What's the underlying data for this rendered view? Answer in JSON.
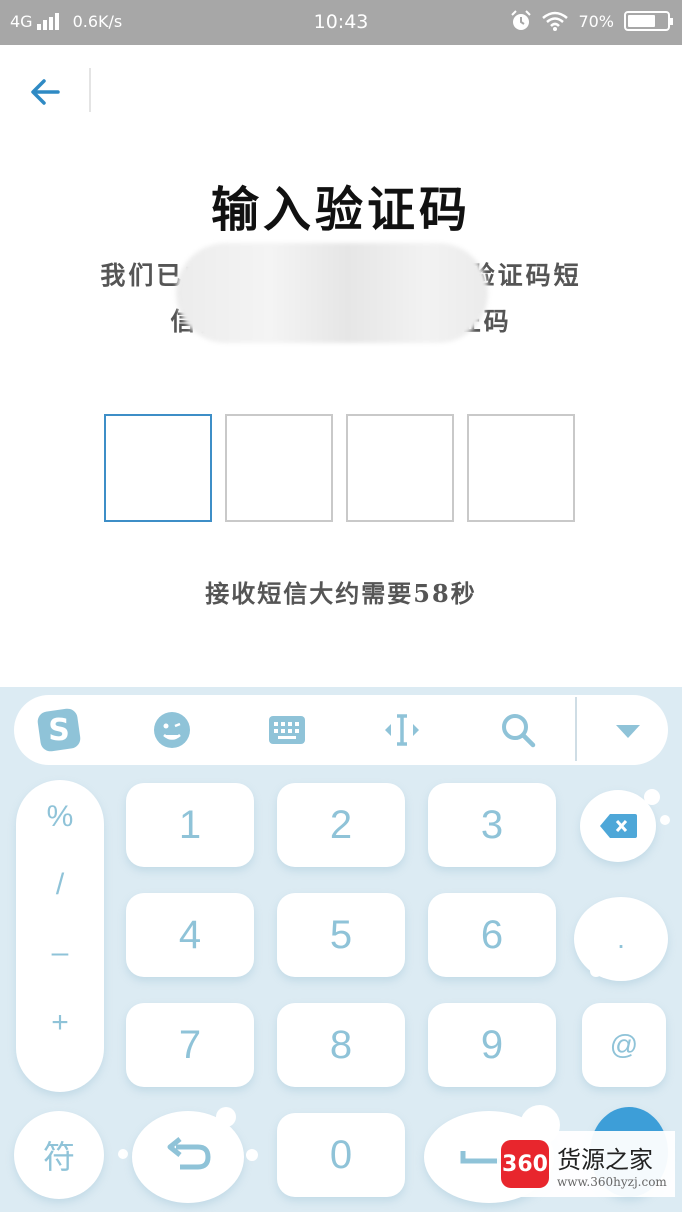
{
  "status_bar": {
    "network": "4G",
    "speed": "0.6K/s",
    "time": "10:43",
    "battery": "70%",
    "battery_level": 0.7
  },
  "header": {
    "back_icon": "arrow-left-icon"
  },
  "page": {
    "title": "输入验证码",
    "subtitle_line1": "我们已向 ████████ 发送验证码短",
    "subtitle_line2": "信，请 ████████ 证码",
    "countdown": "接收短信大约需要58秒"
  },
  "code_input": {
    "length": 4,
    "values": [
      "",
      "",
      "",
      ""
    ],
    "active_index": 0
  },
  "keyboard": {
    "toolbar": [
      "sogou-logo-icon",
      "emoji-icon",
      "keyboard-icon",
      "cursor-move-icon",
      "search-icon",
      "collapse-icon"
    ],
    "symbols": [
      "%",
      "/",
      "–",
      "+"
    ],
    "digits": [
      "1",
      "2",
      "3",
      "4",
      "5",
      "6",
      "7",
      "8",
      "9",
      "0"
    ],
    "fu_label": "符",
    "dot_label": ".",
    "at_label": "@"
  },
  "watermark": {
    "name": "货源之家",
    "url": "www.360hyzj.com",
    "logo": "360"
  },
  "colors": {
    "accent": "#3d8ec7",
    "keyboard_bg": "#dcebf3",
    "key_text": "#8fc3d8"
  }
}
